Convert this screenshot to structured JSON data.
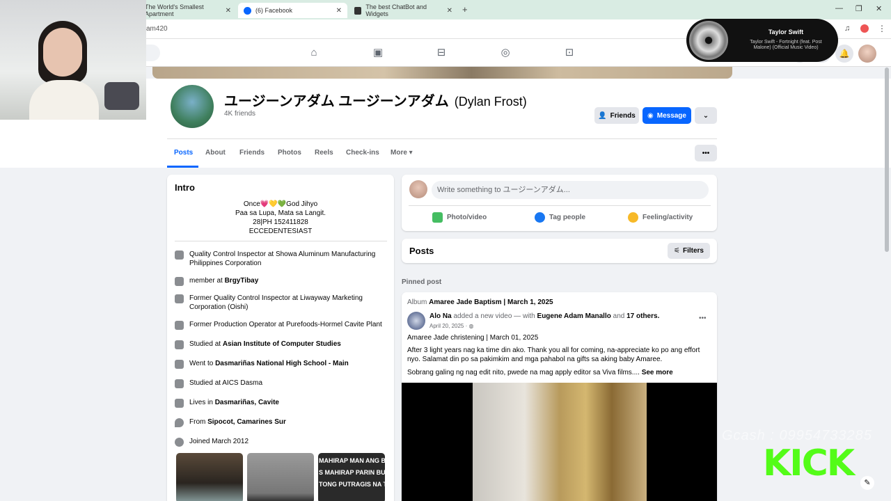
{
  "browser": {
    "tabs": [
      {
        "title": "The World's Smallest Apartment",
        "active": false
      },
      {
        "title": "(6) Facebook",
        "active": true
      },
      {
        "title": "The best ChatBot and Widgets",
        "active": false
      }
    ],
    "url_fragment": "am420"
  },
  "music": {
    "artist": "Taylor Swift",
    "track": "Taylor Swift - Fortnight (feat. Post Malone) (Official Music Video)"
  },
  "profile": {
    "name": "ユージーンアダム ユージーンアダム",
    "alt_name": "(Dylan Frost)",
    "friends": "4K friends",
    "friends_btn": "Friends",
    "message_btn": "Message",
    "tabs": [
      "Posts",
      "About",
      "Friends",
      "Photos",
      "Reels",
      "Check-ins",
      "More ▾"
    ]
  },
  "intro": {
    "title": "Intro",
    "bio": [
      "Once💗💛💚God Jihyo",
      "Paa sa Lupa, Mata sa Langit.",
      "28|PH 152411828",
      "ECCEDENTESIAST"
    ],
    "items": [
      {
        "pre": "Quality Control Inspector at Showa Aluminum Manufacturing Philippines Corporation",
        "bold": ""
      },
      {
        "pre": "member at ",
        "bold": "BrgyTibay"
      },
      {
        "pre": "Former Quality Control Inspector at Liwayway Marketing Corporation (Oishi)",
        "bold": ""
      },
      {
        "pre": "Former Production Operator at Purefoods-Hormel Cavite Plant",
        "bold": ""
      },
      {
        "pre": "Studied at ",
        "bold": "Asian Institute of Computer Studies"
      },
      {
        "pre": "Went to ",
        "bold": "Dasmariñas National High School - Main"
      },
      {
        "pre": "Studied at AICS Dasma",
        "bold": ""
      },
      {
        "pre": "Lives in ",
        "bold": "Dasmariñas, Cavite"
      },
      {
        "pre": "From ",
        "bold": "Sipocot, Camarines Sur"
      },
      {
        "pre": "Joined March 2012",
        "bold": ""
      }
    ],
    "photo3_text": "MAHIRAP MAN ANG BUH\nS MAHIRAP PARIN BUKS\nTONG PUTRAGIS NA T"
  },
  "composer": {
    "placeholder": "Write something to ユージーンアダム...",
    "photo": "Photo/video",
    "tag": "Tag people",
    "feeling": "Feeling/activity"
  },
  "posts": {
    "title": "Posts",
    "filters": "Filters",
    "pinned": "Pinned post",
    "album_prefix": "Album",
    "album": "Amaree Jade Baptism | March 1, 2025",
    "author": "Alo Na",
    "action": "added a new video — with",
    "tagged": "Eugene Adam Manallo",
    "and": "and",
    "others": "17 others.",
    "date": "April 20, 2025 · ",
    "line1": "Amaree Jade christening | March 01, 2025",
    "line2": "After 3 light years nag ka time din ako. Thank you all for coming, na-appreciate ko po ang effort nyo. Salamat din po sa pakimkim and mga pahabol na gifts sa aking baby Amaree.",
    "line3": "Sobrang galing ng nag edit nito, pwede na mag apply editor sa Viva films....",
    "see_more": "See more"
  },
  "overlay": {
    "gcash": "Gcash : 09954733285",
    "kick": "KICK"
  },
  "colors": {
    "accent": "#0866ff",
    "kick": "#53fc18"
  }
}
